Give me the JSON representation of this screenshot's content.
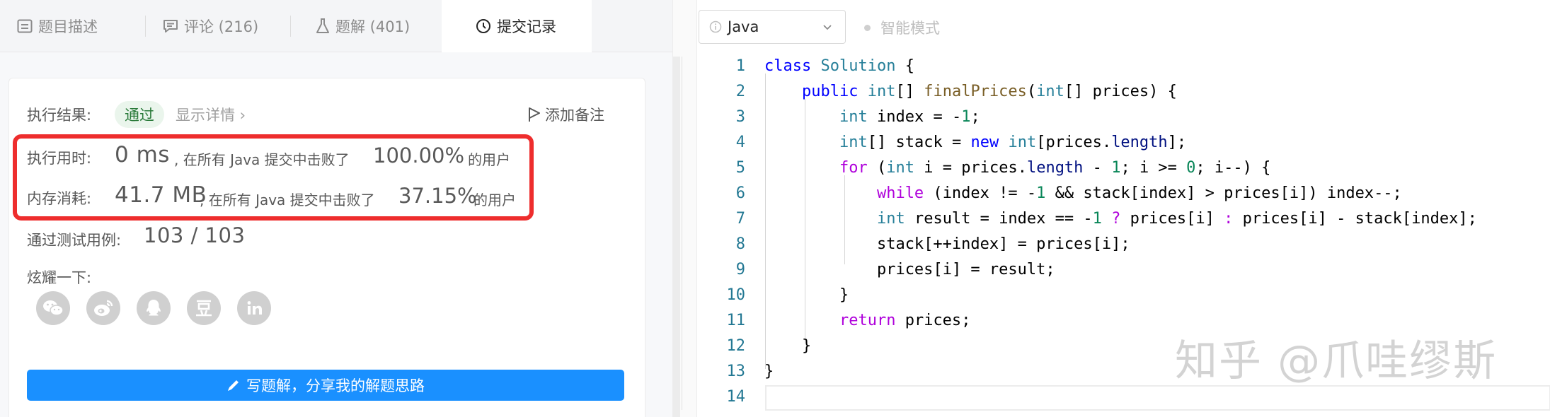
{
  "tabs": [
    {
      "label": "题目描述",
      "icon": "description-icon"
    },
    {
      "label": "评论 (216)",
      "icon": "comment-icon"
    },
    {
      "label": "题解 (401)",
      "icon": "flask-icon"
    },
    {
      "label": "提交记录",
      "icon": "clock-icon",
      "active": true
    }
  ],
  "result": {
    "label": "执行结果:",
    "status": "通过",
    "detail_link": "显示详情 ›",
    "note_button": "添加备注"
  },
  "runtime": {
    "label": "执行用时:",
    "value": "0 ms",
    "beat_text": ", 在所有 Java 提交中击败了",
    "percent": "100.00%",
    "suffix": "的用户"
  },
  "memory": {
    "label": "内存消耗:",
    "value": "41.7 MB",
    "beat_text": ", 在所有 Java 提交中击败了",
    "percent": "37.15%",
    "suffix": "的用户"
  },
  "tests": {
    "label": "通过测试用例:",
    "value": "103 / 103"
  },
  "share": {
    "label": "炫耀一下:",
    "icons": [
      "wechat-icon",
      "weibo-icon",
      "qq-icon",
      "douban-icon",
      "linkedin-icon"
    ]
  },
  "write_solution_button": "写题解，分享我的解题思路",
  "editor": {
    "language": "Java",
    "smart_mode": "智能模式",
    "line_numbers": [
      "1",
      "2",
      "3",
      "4",
      "5",
      "6",
      "7",
      "8",
      "9",
      "10",
      "11",
      "12",
      "13",
      "14"
    ],
    "code_lines": [
      "class Solution {",
      "    public int[] finalPrices(int[] prices) {",
      "        int index = -1;",
      "        int[] stack = new int[prices.length];",
      "        for (int i = prices.length - 1; i >= 0; i--) {",
      "            while (index != -1 && stack[index] > prices[i]) index--;",
      "            int result = index == -1 ? prices[i] : prices[i] - stack[index];",
      "            stack[++index] = prices[i];",
      "            prices[i] = result;",
      "        }",
      "        return prices;",
      "    }",
      "}",
      ""
    ]
  },
  "watermark": "知乎 @爪哇缪斯",
  "colors": {
    "accent": "#1a90ff",
    "pass_bg": "#eaf5ec",
    "pass_text": "#2a7a3a",
    "highlight_border": "#ee2d2d",
    "keyword": "#0000ff",
    "type": "#267f99",
    "function": "#795e26",
    "number": "#098658",
    "control": "#af00db",
    "line_number": "#237893"
  }
}
